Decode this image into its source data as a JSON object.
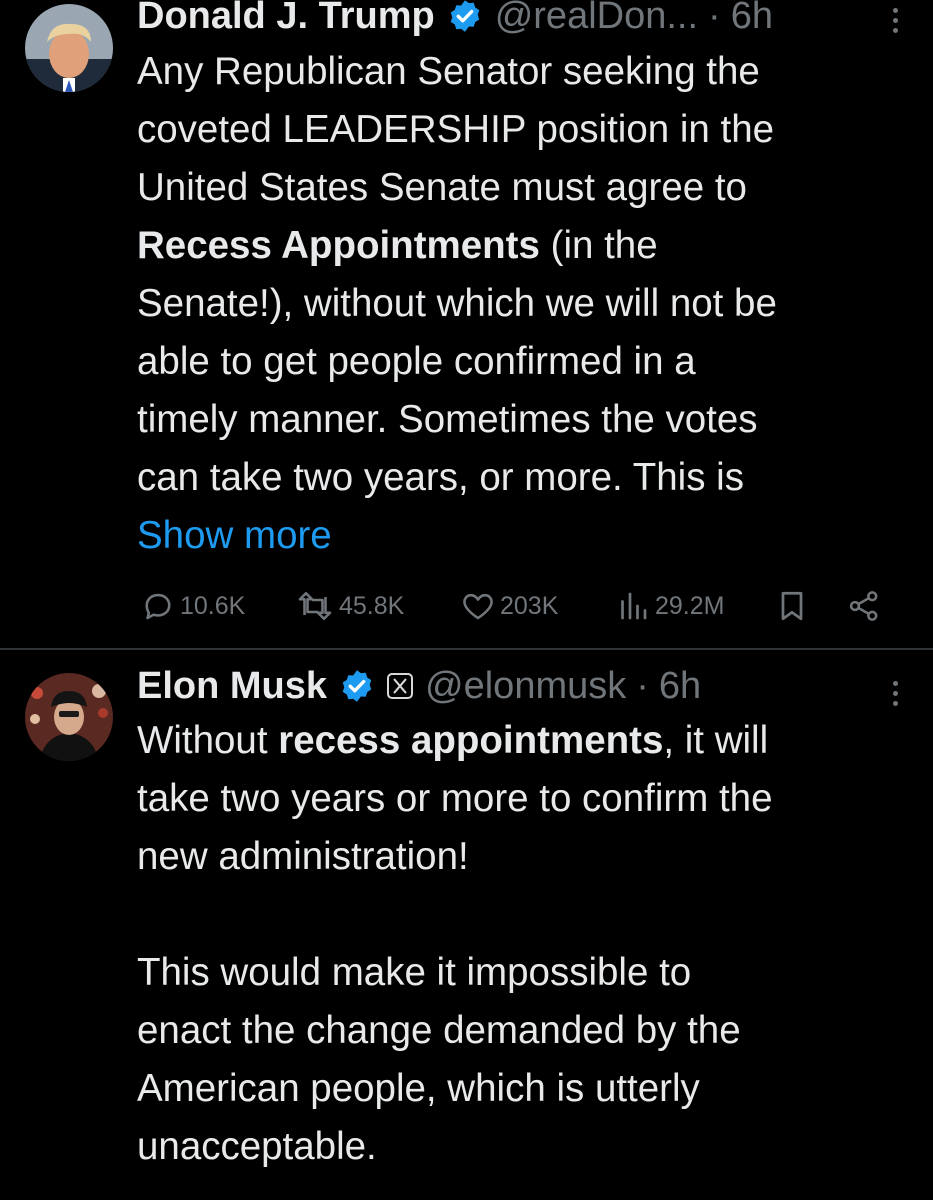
{
  "tweets": [
    {
      "author_name": "Donald J. Trump",
      "handle": "@realDon...",
      "dot": "·",
      "time": "6h",
      "lines": [
        "Any Republican Senator seeking the",
        "coveted LEADERSHIP position in the",
        "United States Senate must agree to",
        "",
        "Senate!), without which we will not be",
        "able to get people confirmed in a",
        "timely manner. Sometimes the votes",
        "can take two years, or more. This is"
      ],
      "bold_phrase": "Recess Appointments",
      "after_bold": " (in the",
      "show_more": "Show more",
      "stats": {
        "replies": "10.6K",
        "reposts": "45.8K",
        "likes": "203K",
        "views": "29.2M"
      }
    },
    {
      "author_name": "Elon Musk",
      "handle": "@elonmusk",
      "dot": "·",
      "time": "6h",
      "line1_before": "Without ",
      "line1_bold": "recess appointments",
      "line1_after": ", it will",
      "lines": [
        "take two years or more to confirm the",
        "new administration!",
        "",
        "This would make it impossible to",
        "enact the change demanded by the",
        "American people, which is utterly",
        "unacceptable."
      ]
    }
  ],
  "colors": {
    "background": "#000000",
    "text": "#e7e9ea",
    "secondary": "#71767b",
    "link": "#1d9bf0",
    "verified": "#1d9bf0"
  }
}
